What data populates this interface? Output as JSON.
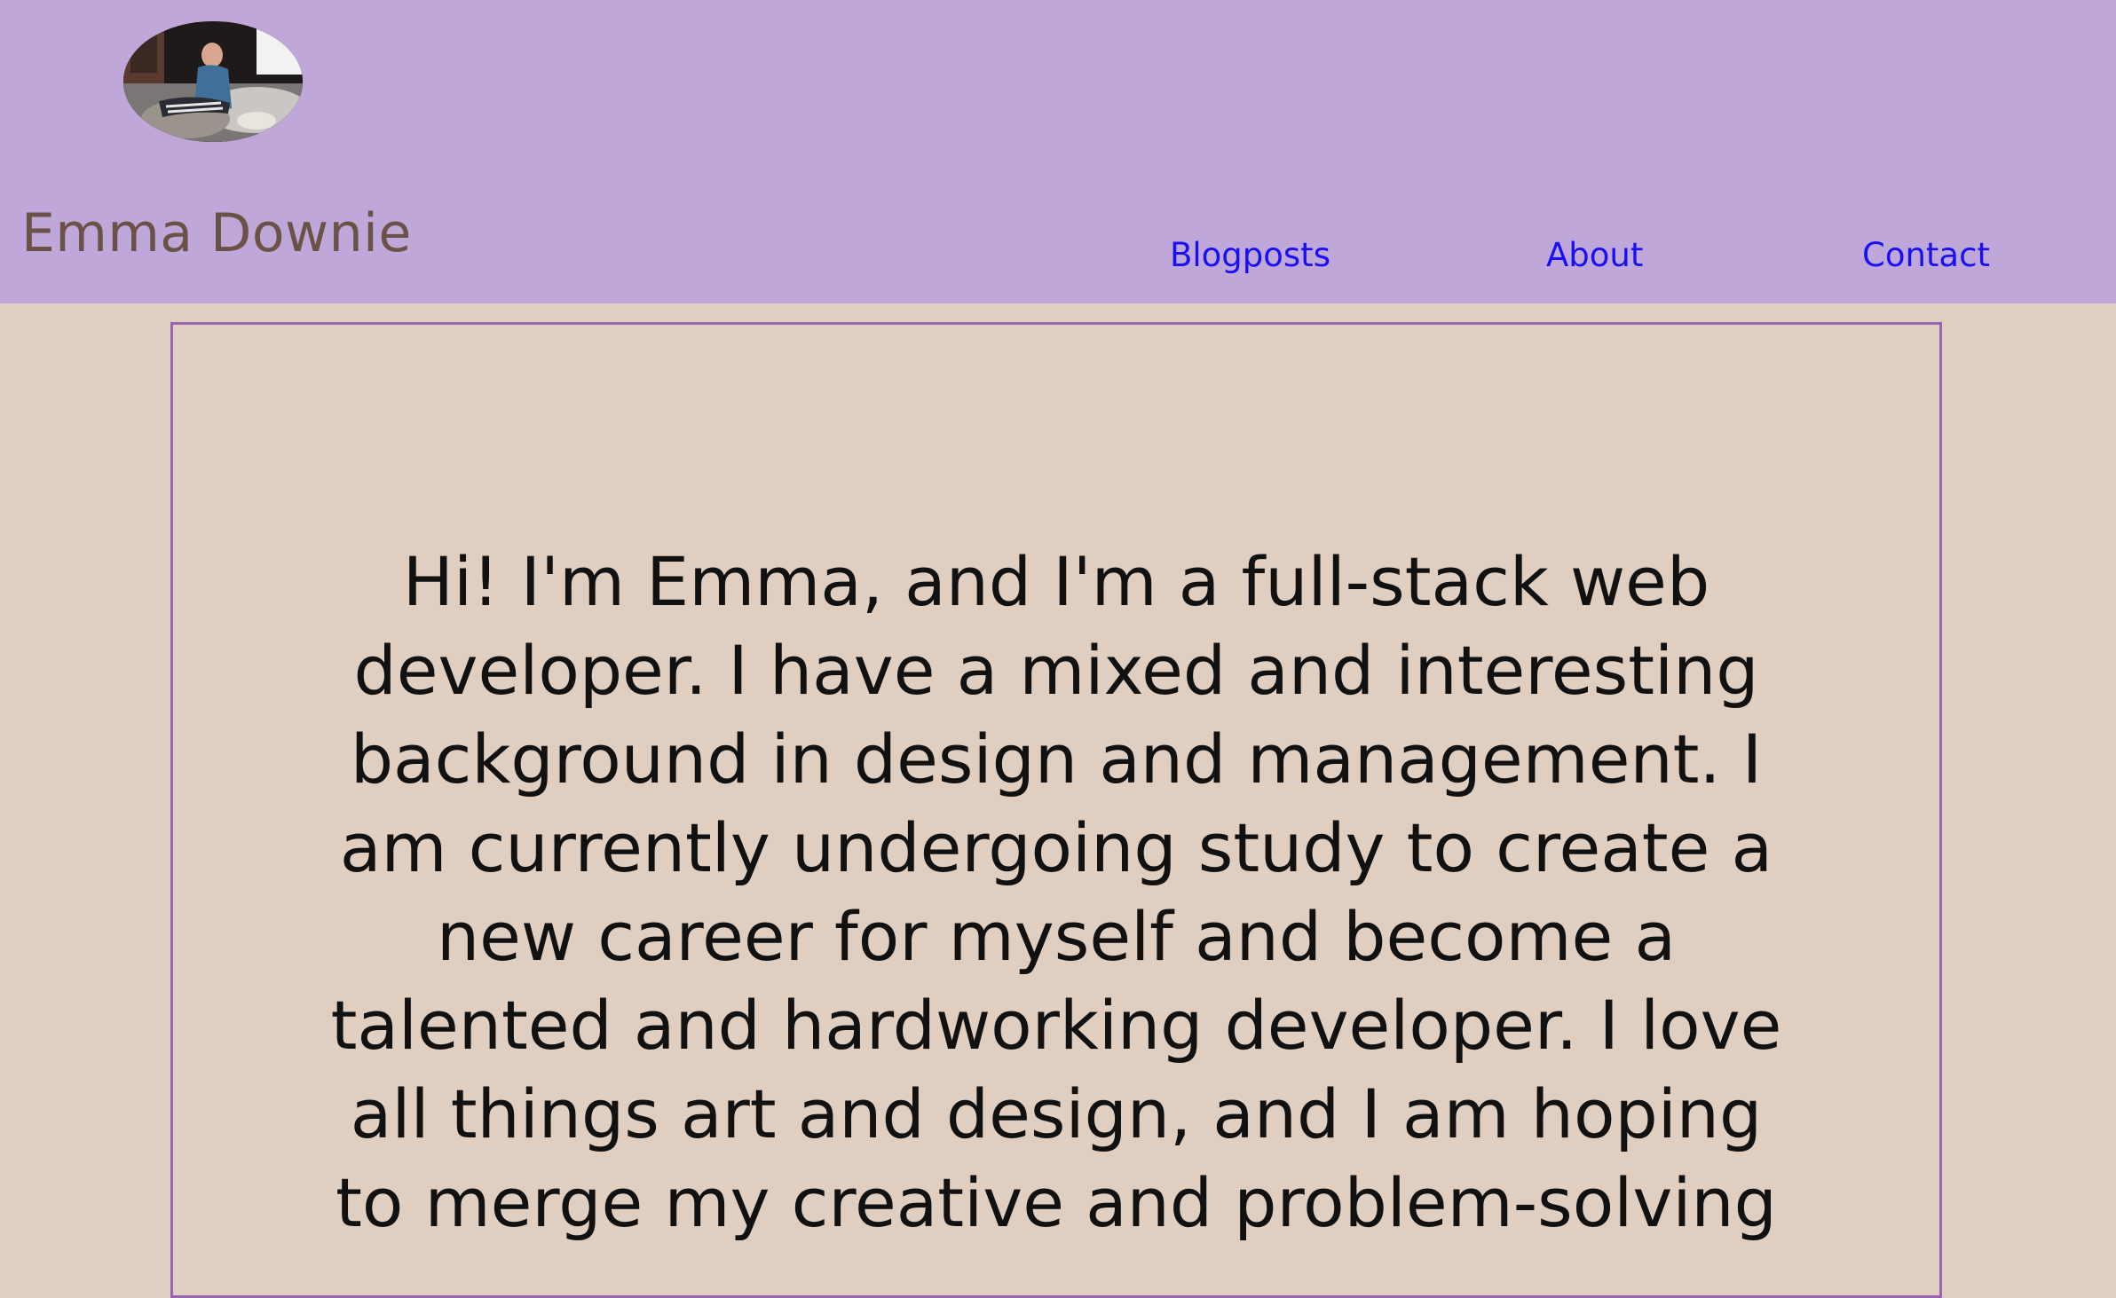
{
  "header": {
    "avatar_icon": "profile-photo",
    "site_title": "Emma Downie",
    "nav": [
      {
        "label": "Blogposts"
      },
      {
        "label": "About"
      },
      {
        "label": "Contact"
      }
    ]
  },
  "main": {
    "intro_text": "Hi! I'm Emma, and I'm a full-stack web developer. I have a mixed and interesting background in design and management. I am currently undergoing study to create a new career for myself and become a talented and hardworking developer. I love all things art and design, and I am hoping to merge my creative and problem-solving"
  },
  "colors": {
    "header_bg": "#c0a7d9",
    "page_bg": "#e0cfc1",
    "title_color": "#6b5247",
    "link_color": "#1a0ff2",
    "box_border": "#9b64b2"
  }
}
